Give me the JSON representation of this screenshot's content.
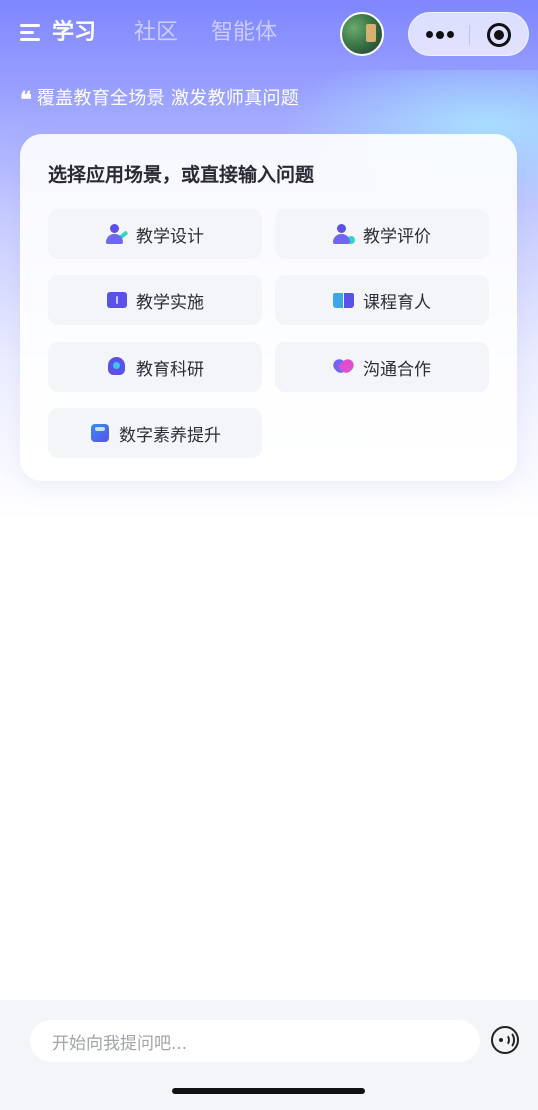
{
  "nav": {
    "tabs": [
      {
        "label": "学习",
        "active": true
      },
      {
        "label": "社区",
        "active": false
      },
      {
        "label": "智能体",
        "active": false
      }
    ]
  },
  "slogan": {
    "text": "覆盖教育全场景 激发教师真问题"
  },
  "card": {
    "title": "选择应用场景，或直接输入问题",
    "scenes": [
      {
        "label": "教学设计",
        "icon": "teacher-edit-icon"
      },
      {
        "label": "教学评价",
        "icon": "teacher-evaluate-icon"
      },
      {
        "label": "教学实施",
        "icon": "book-icon"
      },
      {
        "label": "课程育人",
        "icon": "open-book-icon"
      },
      {
        "label": "教育科研",
        "icon": "brain-icon"
      },
      {
        "label": "沟通合作",
        "icon": "heart-handshake-icon"
      },
      {
        "label": "数字素养提升",
        "icon": "cube-icon"
      }
    ]
  },
  "composer": {
    "placeholder": "开始向我提问吧..."
  },
  "colors": {
    "accent": "#5a52e8",
    "gradient_top": "#7f86ff",
    "text_primary": "#2a2a35",
    "placeholder": "#a2a4ad"
  }
}
